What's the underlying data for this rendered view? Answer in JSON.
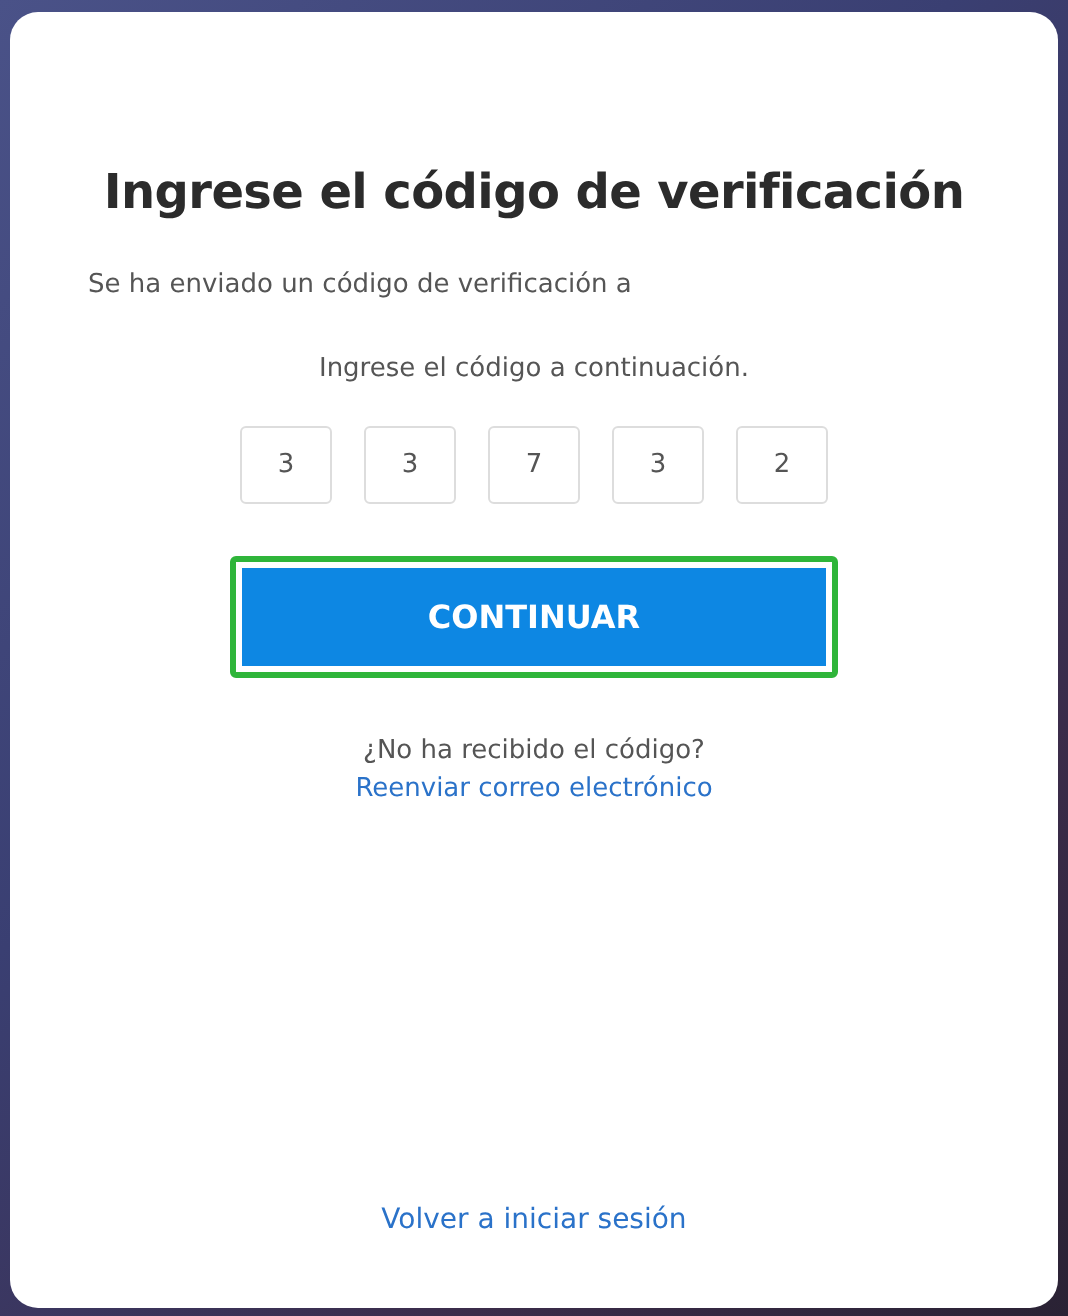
{
  "title": "Ingrese el código de verificación",
  "sent_message": "Se ha enviado un código de verificación a",
  "instruction": "Ingrese el código a continuación.",
  "code_digits": [
    "3",
    "3",
    "7",
    "3",
    "2"
  ],
  "continue_button": {
    "label": "CONTINUAR",
    "focused": true
  },
  "resend_prompt": "¿No ha recibido el código?",
  "resend_link": "Reenviar correo electrónico",
  "back_link": "Volver a iniciar sesión"
}
